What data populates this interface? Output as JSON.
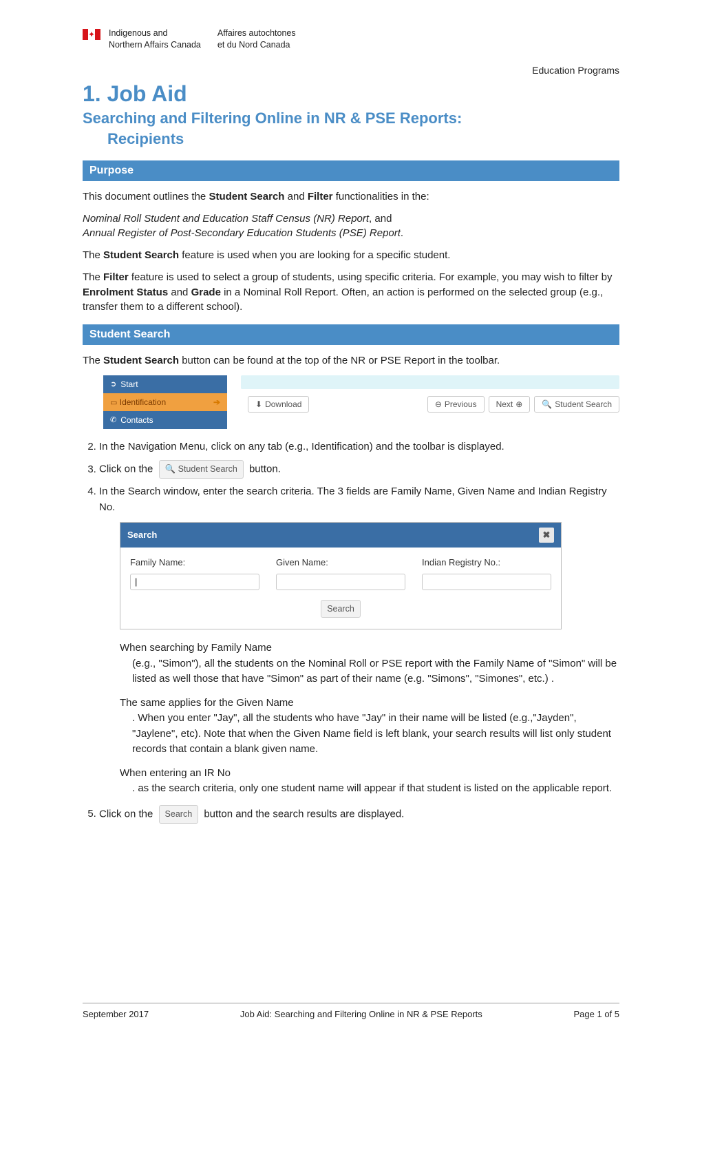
{
  "header": {
    "dept_en_line1": "Indigenous and",
    "dept_en_line2": "Northern Affairs Canada",
    "dept_fr_line1": "Affaires autochtones",
    "dept_fr_line2": "et du Nord Canada",
    "program": "Education Programs"
  },
  "title": {
    "number_prefix": "1.  Job Aid",
    "subtitle_line1": "Searching and Filtering Online in NR & PSE Reports:",
    "subtitle_line2": "Recipients"
  },
  "sections": {
    "purpose_label": "Purpose",
    "student_search_label": "Student Search"
  },
  "purpose": {
    "p1_a": "This document outlines the ",
    "p1_b": "Student Search",
    "p1_c": " and ",
    "p1_d": "Filter",
    "p1_e": " functionalities in the:",
    "p2": "Nominal Roll Student and Education Staff Census (NR) Report",
    "p2_tail": ", and",
    "p3": "Annual Register of Post-Secondary Education Students (PSE) Report",
    "p3_tail": ".",
    "p4_a": "The ",
    "p4_b": "Student Search",
    "p4_c": " feature is used when you are looking for a specific student.",
    "p5_a": "The ",
    "p5_b": "Filter",
    "p5_c": " feature is used to select a group of students, using specific criteria. For example, you may wish to filter by ",
    "p5_d": "Enrolment Status",
    "p5_e": " and ",
    "p5_f": "Grade",
    "p5_g": " in a Nominal Roll Report. Often, an action is performed on the selected group (e.g., transfer them to a different school)."
  },
  "student_search": {
    "intro_a": "The ",
    "intro_b": "Student Search",
    "intro_c": " button can be found at the top of the NR or PSE Report in the toolbar."
  },
  "nav": {
    "start": "Start",
    "identification": "Identification",
    "contacts": "Contacts"
  },
  "toolbar": {
    "download": "Download",
    "previous": "Previous",
    "next": "Next",
    "student_search": "Student Search"
  },
  "steps": {
    "s2_a": "In the ",
    "s2_b": "Navigation Menu",
    "s2_c": ", click on any tab (e.g., ",
    "s2_d": "Identification",
    "s2_e": ") and the toolbar is displayed.",
    "s3_a": "Click on the",
    "s3_b": "button.",
    "s4_a": "In the ",
    "s4_b": "Search",
    "s4_c": " window, enter the search criteria. The 3 fields are ",
    "s4_d": "Family Name",
    "s4_e": ", ",
    "s4_f": "Given Name",
    "s4_g": " and ",
    "s4_h": "Indian Registry No.",
    "s5_a": "Click on the",
    "s5_b": "button and the search results are displayed."
  },
  "search_dialog": {
    "title": "Search",
    "family_name": "Family Name:",
    "given_name": "Given Name:",
    "irn": "Indian Registry No.:",
    "search_btn": "Search"
  },
  "search_notes": {
    "n1_a": "When searching by ",
    "n1_b": "Family Name",
    "n1_c": " (e.g., \"Simon\"), all the students on the Nominal Roll or PSE report with the Family Name of \"Simon\" will be listed as well those that have \"Simon\" as part of their name (e.g. \"Simons\", \"Simones\", etc.) .",
    "n2_a": "The same applies for the ",
    "n2_b": "Given Name",
    "n2_c": ". When you enter \"Jay\", all the students who have \"Jay\" in their name will be listed (e.g.,\"Jayden\", \"Jaylene\",  etc). Note that when the Given Name field is left blank, your search results will list only student records that contain a blank given name.",
    "n3_a": "When entering an ",
    "n3_b": "IR No",
    "n3_c": ". as the search criteria, only one student name will appear if that student is listed on the applicable report."
  },
  "inline_buttons": {
    "student_search": "Student Search",
    "search": "Search"
  },
  "footer": {
    "left": "September 2017",
    "center": "Job Aid: Searching and Filtering Online in NR & PSE Reports",
    "right": "Page 1 of 5"
  }
}
